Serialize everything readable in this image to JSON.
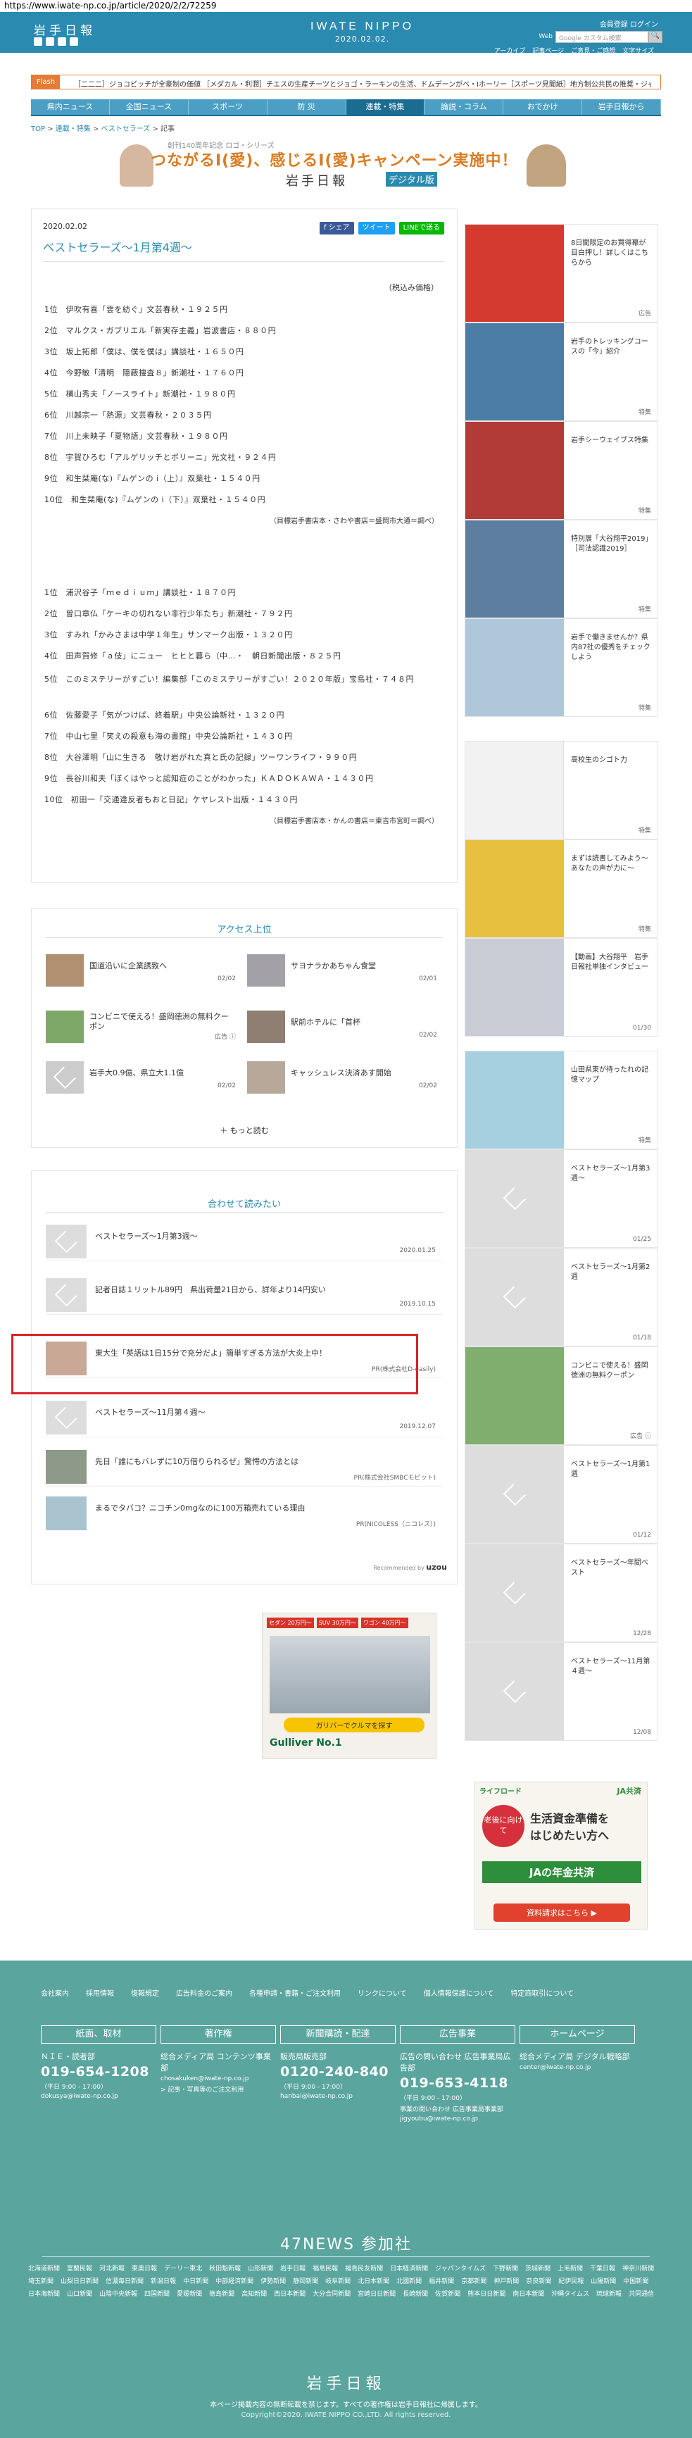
{
  "url": "https://www.iwate-np.co.jp/article/2020/2/2/72259",
  "header": {
    "logo": "岩手日報",
    "center_logo": "IWATE NIPPO",
    "center_date": "2020.02.02.",
    "member_register": "会員登録",
    "login": "ログイン",
    "web_search_label": "Web",
    "search_placeholder": "Google カスタム検索",
    "search_button": "🔍",
    "links": [
      "アーカイブ",
      "記事ページ",
      "ご意見・ご感想",
      "文字サイズ"
    ]
  },
  "flash": {
    "label": "Flash",
    "text": "［二二二］ジョコビッチが全豪制の価値 ［メダカル・利潤］チエスの生産チーツとジョゴ・ラーキンの生活、ドムデーンがベ・Iホーリー［スポーツ見聞紙］地方制公共民の推奨・ジャポビィ・"
  },
  "nav": [
    "県内ニュース",
    "全国ニュース",
    "スポーツ",
    "防 災",
    "連載・特集",
    "論説・コラム",
    "おでかけ",
    "岩手日報から"
  ],
  "breadcrumb": [
    "TOP",
    "連載・特集",
    "ベストセラーズ",
    "記事"
  ],
  "banner": {
    "sub": "創刊140周年記念 ロゴ・シリーズ",
    "main": "つながるI(愛)、感じるI(愛)キャンペーン実施中！",
    "logo": "岩手日報",
    "digital": "デジタル版"
  },
  "article": {
    "date": "2020.02.02",
    "title": "ベストセラーズ～1月第4週～",
    "share_fb": "f シェア",
    "share_tw": "ツイート",
    "share_line": "LINEで送る",
    "tax_note": "（税込み価格）",
    "list1": [
      "1位　伊吹有喜「雲を紡ぐ」文芸春秋・１９２５円",
      "2位　マルクス・ガブリエル「新実存主義」岩波書店・８８０円",
      "3位　坂上拓郎「僕は、僕を僕は」講談社・１６５０円",
      "4位　今野敏「清明　隠蔽捜査８」新潮社・１７６０円",
      "5位　横山秀夫「ノースライト」新潮社・１９８０円",
      "6位　川越宗一「熱源」文芸春秋・２０３５円",
      "7位　川上未映子「夏物語」文芸春秋・１９８０円",
      "8位　宇賀ひろむ「アルゲリッチとポリーニ」光文社・９２４円",
      "9位　和生栞庵(な)『ムゲンの i（上）』双葉社・１５４０円",
      "10位　和生栞庵(な)『ムゲンの i（下）』双葉社・１５４０円"
    ],
    "source1": "（目標岩手書店本・さわや書店＝盛岡市大通＝調べ）",
    "list2": [
      "1位　浦沢谷子「ｍｅｄｉｕｍ」講談社・１８７０円",
      "2位　曽口章仏「ケーキの切れない非行少年たち」新潮社・７９２円",
      "3位　すみれ「かみさまは中学１年生」サンマーク出版・１３２０円",
      "4位　田声賀修「ａ伎」にニュー　ヒヒと暮ら（中…・　朝日新聞出版・８２５円",
      "5位　このミステリーがすごい！編集部「このミステリーがすごい！２０２０年版」宝島社・７４８円",
      "6位　佐藤愛子「気がつけば、終着駅」中央公論新社・１３２０円",
      "7位　中山七里「笑えの殺意も海の書館」中央公論新社・１４３０円",
      "8位　大谷澤明「山に生きる　敬け岩がれた真と氏の記録」ツーワンライフ・９９０円",
      "9位　長谷川和夫「ぼくはやっと認知症のことがわかった」ＫＡＤＯＫＡＷＡ・１４３０円",
      "10位　初田一「交通違反者もおと日記」ケヤレスト出版・１４３０円"
    ],
    "source2": "（目標岩手書店本・かんの書店＝東吉市宮町＝調べ）"
  },
  "access": {
    "heading": "アクセス上位",
    "items": [
      {
        "text": "国道沿いに企業誘致へ",
        "date": "02/02"
      },
      {
        "text": "サヨナラかあちゃん食堂",
        "date": "02/01"
      },
      {
        "text": "コンビニで使える！盛岡徳洲の無料クーポン",
        "date": "広告 ⓘ"
      },
      {
        "text": "駅前ホテルに「首杯",
        "date": "02/02"
      },
      {
        "text": "岩手大0.9億、県立大1.1億",
        "date": "02/02"
      },
      {
        "text": "キャッシュレス決済あす開始",
        "date": "02/02"
      }
    ],
    "more": "もっと読む"
  },
  "related": {
    "heading": "合わせて読みたい",
    "items": [
      {
        "text": "ベストセラーズ～1月第3週～",
        "date": "2020.01.25"
      },
      {
        "text": "記者日誌１リットル89円　県出荷量21日から、詳年より14円安い",
        "date": "2019.10.15"
      },
      {
        "text": "東大生「英語は1日15分で充分だよ」簡単すぎる方法が大炎上中！",
        "date": "PR(株式会社D-easily)"
      },
      {
        "text": "ベストセラーズ～11月第４週～",
        "date": "2019.12.07"
      },
      {
        "text": "先日「誰にもバレずに10万借りられるぜ」驚愕の方法とは",
        "date": "PR(株式会社SMBCモビット)"
      },
      {
        "text": "まるでタバコ？ニコチン0mgなのに100万箱売れている理由",
        "date": "PR(NICOLESS（ニコレス）)"
      }
    ],
    "recommend": "Recommended by",
    "recommend_logo": "uzou"
  },
  "sidebar": [
    {
      "text": "8日間限定のお買得幕が目白押し！詳しくはこちらから",
      "label": "広告"
    },
    {
      "text": "岩手のトレッキングコースの「今」紹介",
      "label": "特集"
    },
    {
      "text": "岩手シーウェイブス特集",
      "label": "特集"
    },
    {
      "text": "特別展「大谷翔平2019」［司法認識2019］",
      "label": "特集"
    },
    {
      "text": "岩手で働きませんか？県内87社の優秀をチェックしよう",
      "label": "特集"
    },
    {
      "text": "高校生のシゴト力",
      "label": "特集"
    },
    {
      "text": "まずは読書してみよう～あなたの声が力に～",
      "label": "特集"
    },
    {
      "text": "【動画】大谷翔平　岩手日報社単独インタビュー",
      "label": "01/30"
    },
    {
      "text": "山田県東が待ったれの記憶マップ",
      "label": "特集"
    },
    {
      "text": "ベストセラーズ～1月第3週～",
      "label": "01/25"
    },
    {
      "text": "ベストセラーズ～1月第2週",
      "label": "01/18"
    },
    {
      "text": "コンビニで使える！盛岡徳洲の無料クーポン",
      "label": "広告 ⓘ"
    },
    {
      "text": "ベストセラーズ～1月第1週",
      "label": "01/12"
    },
    {
      "text": "ベストセラーズ～年間ベスト",
      "label": "12/28"
    },
    {
      "text": "ベストセラーズ～11月第４週～",
      "label": "12/08"
    }
  ],
  "ad_car": {
    "tags": [
      "セダン 20万円～",
      "SUV 30万円～",
      "ワゴン 40万円～"
    ],
    "bottom": "ガリバーでクルマを探す",
    "brand": "Gulliver No.1"
  },
  "ad_ja": {
    "top_left": "ライフロード",
    "top_right": "JA共済",
    "circle": "老後に向けて",
    "main1": "生活資金準備を",
    "main2": "はじめたい方へ",
    "banner": "JAの年金共済",
    "button": "資料請求はこちら ▶"
  },
  "footer": {
    "links": [
      "会社案内",
      "採用情報",
      "復報規定",
      "広告料金のご案内",
      "各種申請・書籍・ご注文利用",
      "リンクについて",
      "個人情報保護について",
      "特定商取引について"
    ],
    "cols": [
      {
        "head": "紙面、取材",
        "l1": "ＮＩＥ・読者部",
        "big": "019-654-1208",
        "sm1": "（平日 9:00 - 17:00）",
        "sm2": "dokusya@iwate-np.co.jp",
        "sm3": ""
      },
      {
        "head": "著作権",
        "l1": "総合メディア局 コンテンツ事業部",
        "big": "",
        "sm1": "chosakuken@iwate-np.co.jp",
        "sm2": "> 記事・写真等のご注文利用",
        "sm3": ""
      },
      {
        "head": "新聞購読・配達",
        "l1": "販売局販売部",
        "big": "0120-240-840",
        "sm1": "（平日 9:00 - 17:00）",
        "sm2": "hanbai@iwate-np.co.jp",
        "sm3": ""
      },
      {
        "head": "広告事業",
        "l1": "広告の問い合わせ 広告事業局広告部",
        "big": "019-653-4118",
        "sm1": "（平日 9:00 - 17:00）",
        "sm2": "事業の問い合わせ 広告事業局事業部",
        "sm3": "jigyoubu@iwate-np.co.jp"
      },
      {
        "head": "ホームページ",
        "l1": "総合メディア局 デジタル戦略部",
        "big": "",
        "sm1": "center@iwate-np.co.jp",
        "sm2": "",
        "sm3": ""
      }
    ],
    "news47": "47NEWS 参加社",
    "papers": [
      "北海道新聞",
      "室蘭民報",
      "河北新報",
      "東奥日報",
      "デーリー東北",
      "秋田魁新報",
      "山形新聞",
      "岩手日報",
      "福島民報",
      "福島民友新聞",
      "日本経済新聞",
      "ジャパンタイムズ",
      "下野新聞",
      "茨城新聞",
      "上毛新聞",
      "千葉日報",
      "神奈川新聞",
      "埼玉新聞",
      "山梨日日新聞",
      "信濃毎日新聞",
      "新潟日報",
      "中日新聞",
      "中部経済新聞",
      "伊勢新聞",
      "静岡新聞",
      "岐阜新聞",
      "北日本新聞",
      "北國新聞",
      "福井新聞",
      "京都新聞",
      "神戸新聞",
      "奈良新聞",
      "紀伊民報",
      "山陽新聞",
      "中国新聞",
      "日本海新聞",
      "山口新聞",
      "山陰中央新報",
      "四国新聞",
      "愛媛新聞",
      "徳島新聞",
      "高知新聞",
      "西日本新聞",
      "大分合同新聞",
      "宮崎日日新聞",
      "長崎新聞",
      "佐賀新聞",
      "熊本日日新聞",
      "南日本新聞",
      "沖縄タイムス",
      "琉球新報",
      "共同通信"
    ],
    "logo": "岩手日報",
    "copy1": "本ページ掲載内容の無断転載を禁じます。すべての著作権は岩手日報社に帰属します。",
    "copy2": "Copyright©2020. IWATE NIPPO CO.,LTD. All rights reserved."
  }
}
